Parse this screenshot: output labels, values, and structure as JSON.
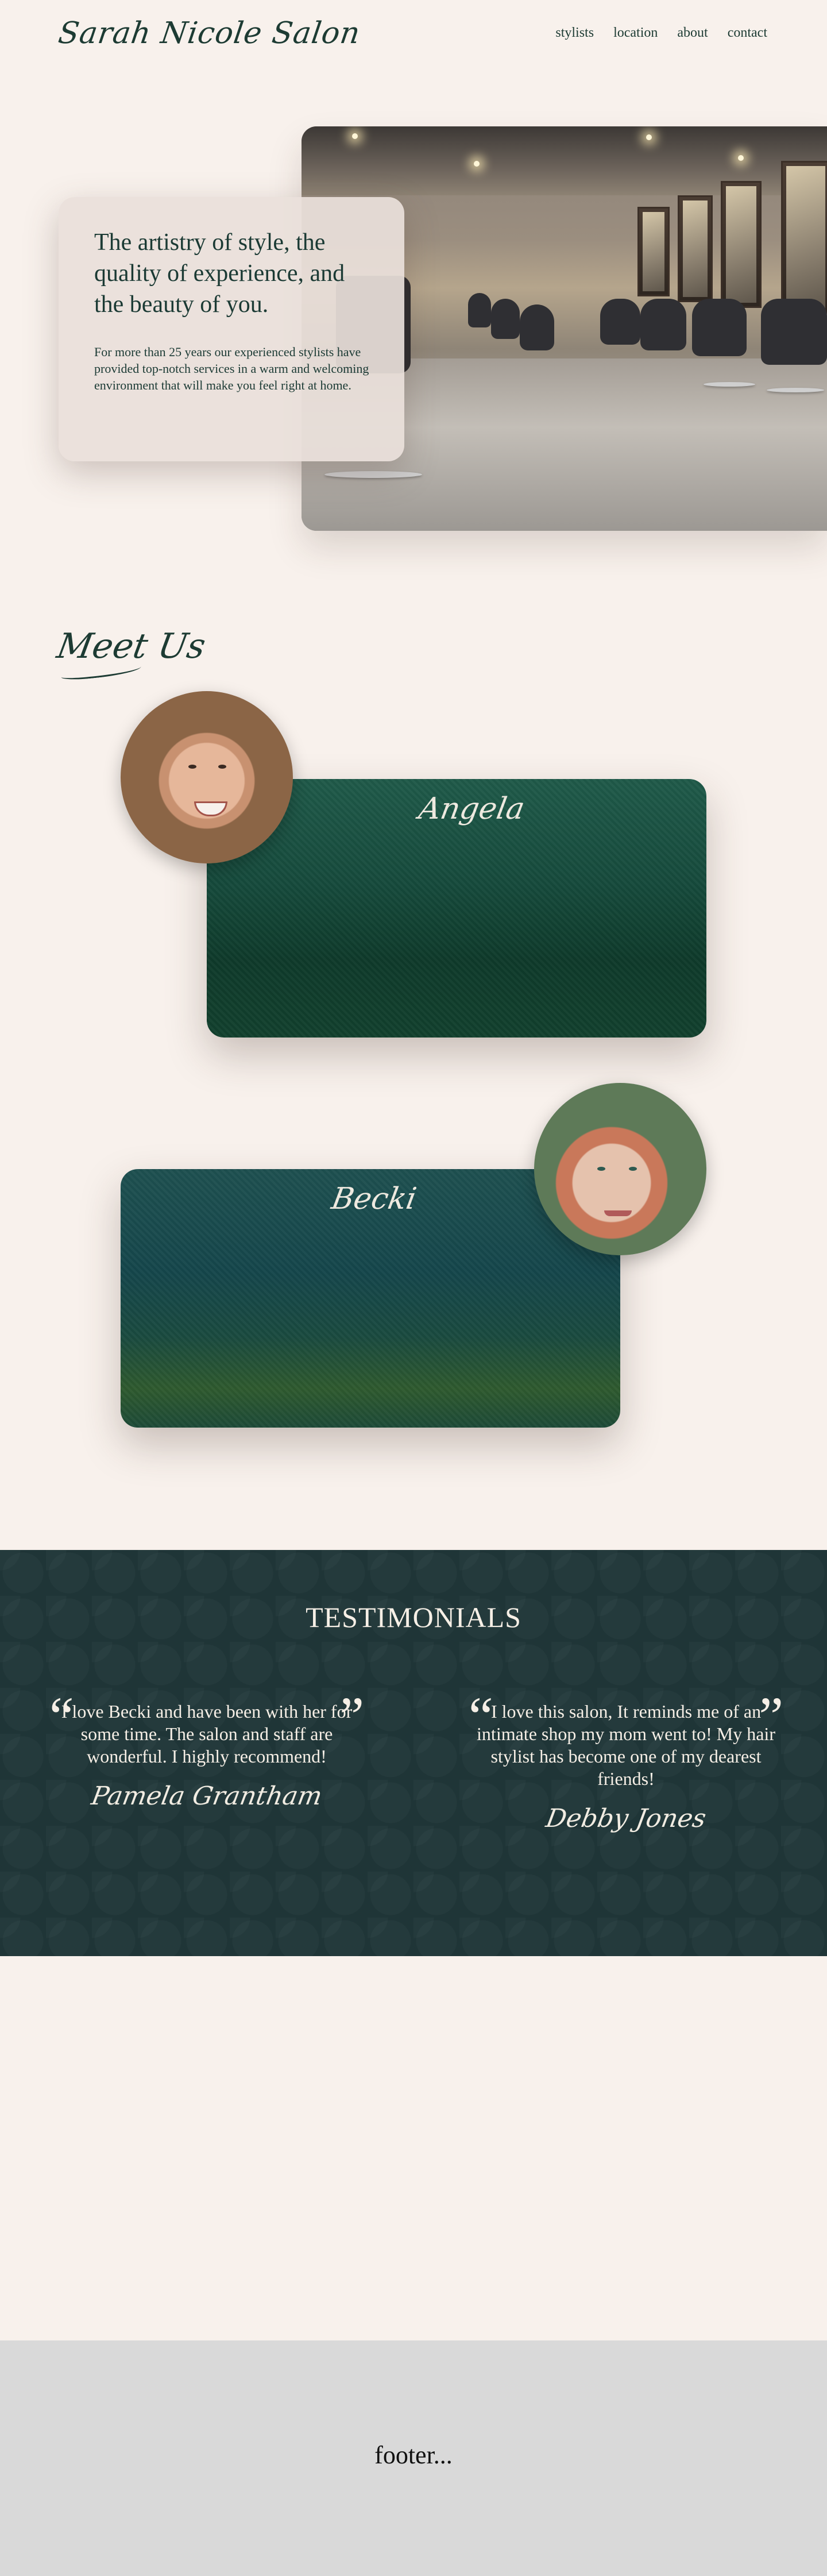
{
  "header": {
    "logo": "Sarah Nicole Salon",
    "nav": [
      "stylists",
      "location",
      "about",
      "contact"
    ]
  },
  "hero": {
    "title": "The artistry of style, the quality of experience, and the beauty of you.",
    "text": "For more than 25 years our experienced stylists have provided top-notch services in a warm and welcoming environment that will make you feel right at home."
  },
  "meet": {
    "title": "Meet Us",
    "staff": [
      {
        "name": "Angela"
      },
      {
        "name": "Becki"
      }
    ]
  },
  "testimonials": {
    "heading": "TESTIMONIALS",
    "items": [
      {
        "quote": "I love Becki and have been with her for some time.  The salon and staff are wonderful.  I highly recommend!",
        "author": "Pamela Grantham"
      },
      {
        "quote": "I love this salon, It reminds me of an intimate shop my mom went to! My hair stylist has become one of my dearest friends!",
        "author": "Debby Jones"
      }
    ],
    "open_mark": "“",
    "close_mark": "”"
  },
  "footer": {
    "text": "footer..."
  },
  "colors": {
    "background": "#f8f1ec",
    "accent": "#1b3a34",
    "testimonial_bg": "#1f3537",
    "footer_bg": "#d9d9d9"
  }
}
